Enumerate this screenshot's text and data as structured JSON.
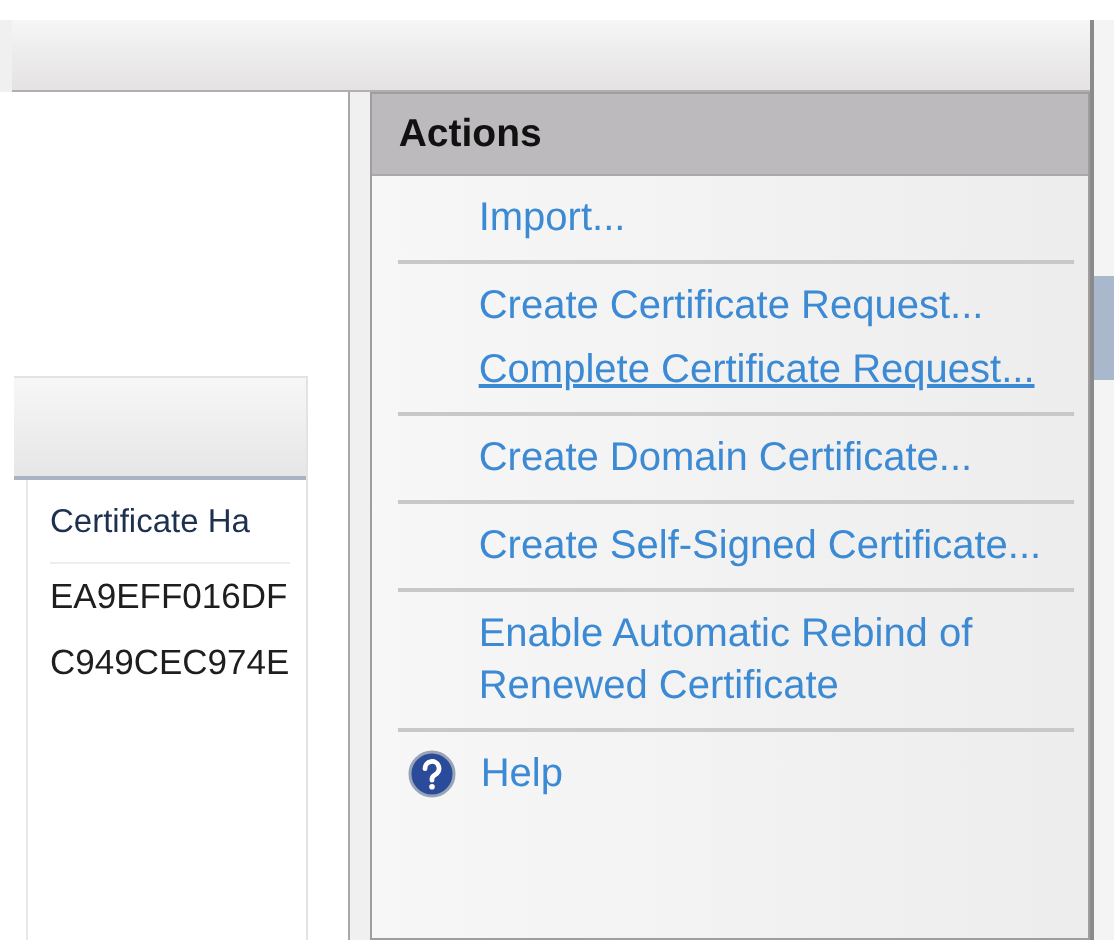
{
  "table": {
    "columns": [
      "Certificate Ha"
    ],
    "rows": [
      [
        "EA9EFF016DF"
      ],
      [
        "C949CEC974E"
      ]
    ]
  },
  "actions": {
    "title": "Actions",
    "groups": [
      [
        {
          "kind": "link",
          "label": "Import...",
          "underlined": false
        }
      ],
      [
        {
          "kind": "link",
          "label": "Create Certificate Request...",
          "underlined": false
        },
        {
          "kind": "link",
          "label": "Complete Certificate Request...",
          "underlined": true
        }
      ],
      [
        {
          "kind": "link",
          "label": "Create Domain Certificate...",
          "underlined": false
        }
      ],
      [
        {
          "kind": "link",
          "label": "Create Self-Signed Certificate...",
          "underlined": false
        }
      ],
      [
        {
          "kind": "link",
          "label": "Enable Automatic Rebind of Renewed Certificate",
          "underlined": false
        }
      ],
      [
        {
          "kind": "help",
          "label": "Help",
          "underlined": false
        }
      ]
    ]
  }
}
